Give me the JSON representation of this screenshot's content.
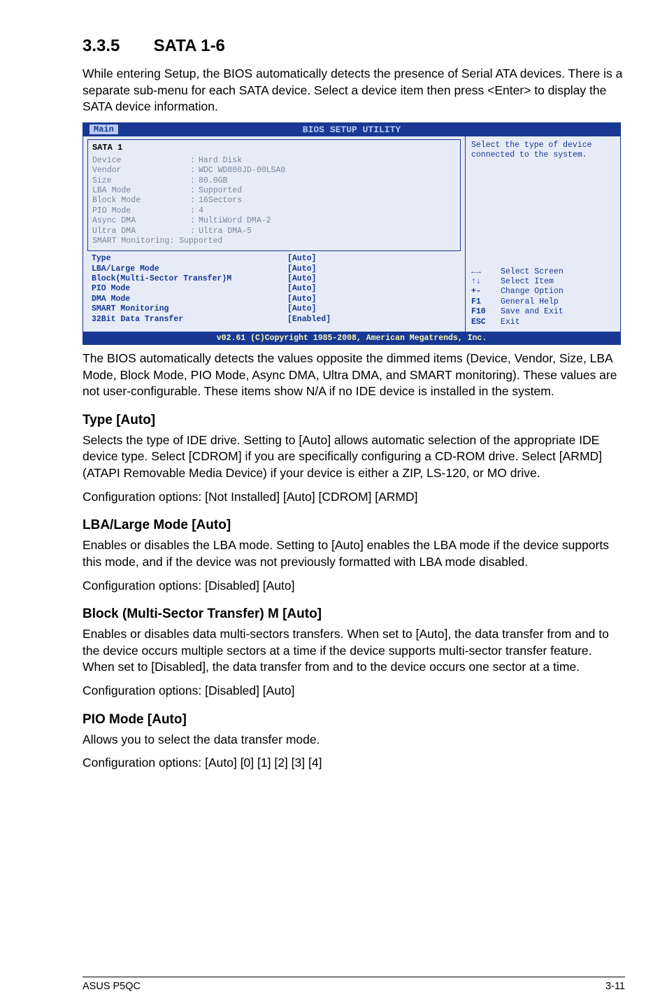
{
  "section": {
    "number": "3.3.5",
    "title": "SATA 1-6"
  },
  "intro": "While entering Setup, the BIOS automatically detects the presence of Serial ATA devices. There is a separate sub-menu for each SATA device. Select a device item then press <Enter> to display the SATA device information.",
  "bios": {
    "title": "BIOS SETUP UTILITY",
    "tab": "Main",
    "footer": "v02.61 (C)Copyright 1985-2008, American Megatrends, Inc.",
    "left": {
      "header": "SATA 1",
      "info": [
        {
          "label": "Device",
          "value": "Hard Disk"
        },
        {
          "label": "Vendor",
          "value": "WDC WD800JD-00LSA0"
        },
        {
          "label": "Size",
          "value": "80.0GB"
        },
        {
          "label": "LBA Mode",
          "value": "Supported"
        },
        {
          "label": "Block Mode",
          "value": "16Sectors"
        },
        {
          "label": "PIO Mode",
          "value": "4"
        },
        {
          "label": "Async DMA",
          "value": "MultiWord DMA-2"
        },
        {
          "label": "Ultra DMA",
          "value": "Ultra DMA-5"
        },
        {
          "label": "SMART Monitoring",
          "value": "Supported",
          "nocolon": true
        }
      ],
      "options": [
        {
          "label": "Type",
          "value": "[Auto]"
        },
        {
          "label": "LBA/Large Mode",
          "value": "[Auto]"
        },
        {
          "label": "Block(Multi-Sector Transfer)M",
          "value": "[Auto]"
        },
        {
          "label": "PIO Mode",
          "value": "[Auto]"
        },
        {
          "label": "DMA Mode",
          "value": "[Auto]"
        },
        {
          "label": "SMART Monitoring",
          "value": "[Auto]"
        },
        {
          "label": "32Bit Data Transfer",
          "value": "[Enabled]"
        }
      ]
    },
    "right": {
      "help": "Select the type of device connected to the system.",
      "legend": [
        {
          "key_icon": "lr",
          "text": "Select Screen"
        },
        {
          "key_icon": "ud",
          "text": "Select Item"
        },
        {
          "key": "+-",
          "text": "Change Option"
        },
        {
          "key": "F1",
          "text": "General Help"
        },
        {
          "key": "F10",
          "text": "Save and Exit"
        },
        {
          "key": "ESC",
          "text": "Exit"
        }
      ]
    }
  },
  "after_bios": "The BIOS automatically detects the values opposite the dimmed items (Device, Vendor, Size, LBA Mode, Block Mode, PIO Mode, Async DMA, Ultra DMA, and SMART monitoring). These values are not user-configurable. These items show N/A if no IDE device is installed in the system.",
  "subsections": [
    {
      "title": "Type [Auto]",
      "paras": [
        "Selects the type of IDE drive. Setting to [Auto] allows automatic selection of the appropriate IDE device type. Select [CDROM] if you are specifically configuring a CD-ROM drive. Select [ARMD] (ATAPI Removable Media Device) if your device is either a ZIP, LS-120, or MO drive.",
        "Configuration options: [Not Installed] [Auto] [CDROM] [ARMD]"
      ]
    },
    {
      "title": "LBA/Large Mode [Auto]",
      "paras": [
        "Enables or disables the LBA mode. Setting to [Auto] enables the LBA mode if the device supports this mode, and if the device was not previously formatted with LBA mode disabled.",
        "Configuration options: [Disabled] [Auto]"
      ]
    },
    {
      "title": "Block (Multi-Sector Transfer) M [Auto]",
      "paras": [
        "Enables or disables data multi-sectors transfers. When set to [Auto], the data transfer from and to the device occurs multiple sectors at a time if the device supports multi-sector transfer feature. When set to [Disabled], the data transfer from and to the device occurs one sector at a time.",
        "Configuration options: [Disabled] [Auto]"
      ]
    },
    {
      "title": "PIO Mode [Auto]",
      "paras": [
        "Allows you to select the data transfer mode.",
        "Configuration options: [Auto] [0] [1] [2] [3] [4]"
      ]
    }
  ],
  "footer": {
    "left": "ASUS P5QC",
    "right": "3-11"
  }
}
